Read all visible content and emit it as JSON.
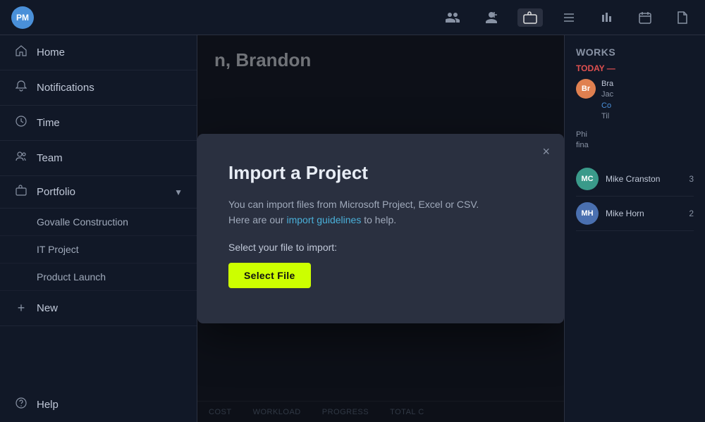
{
  "app": {
    "logo": "PM",
    "title_partial": "n, Brandon"
  },
  "top_nav": {
    "icons": [
      {
        "name": "members-icon",
        "symbol": "👥",
        "active": false
      },
      {
        "name": "team-icon",
        "symbol": "👤",
        "active": false
      },
      {
        "name": "briefcase-icon",
        "symbol": "💼",
        "active": true
      },
      {
        "name": "list-icon",
        "symbol": "≡",
        "active": false
      },
      {
        "name": "chart-icon",
        "symbol": "⏐⏐",
        "active": false
      },
      {
        "name": "calendar-icon",
        "symbol": "📅",
        "active": false
      },
      {
        "name": "document-icon",
        "symbol": "📄",
        "active": false
      }
    ]
  },
  "sidebar": {
    "items": [
      {
        "id": "home",
        "label": "Home",
        "icon": "⌂"
      },
      {
        "id": "notifications",
        "label": "Notifications",
        "icon": "🔔"
      },
      {
        "id": "time",
        "label": "Time",
        "icon": "⏱"
      },
      {
        "id": "team",
        "label": "Team",
        "icon": "👥"
      },
      {
        "id": "portfolio",
        "label": "Portfolio",
        "icon": "📁"
      }
    ],
    "portfolio_projects": [
      {
        "label": "Govalle Construction"
      },
      {
        "label": "IT Project"
      },
      {
        "label": "Product Launch"
      }
    ],
    "new_label": "New",
    "help_label": "Help"
  },
  "modal": {
    "title": "Import a Project",
    "description_part1": "You can import files from Microsoft Project, Excel or CSV.",
    "description_part2": "Here are our ",
    "link_text": "import guidelines",
    "description_part3": " to help.",
    "select_label": "Select your file to import:",
    "select_file_btn": "Select File",
    "close_label": "×"
  },
  "right_panel": {
    "title": "Works",
    "today_label": "TODAY —",
    "activity": [
      {
        "initials": "Br",
        "color": "#e08050",
        "name": "Bra",
        "text": "Jac\nCo\nTil"
      }
    ],
    "description_text": "Phi\nfina"
  },
  "members": [
    {
      "initials": "MC",
      "name": "Mike Cranston",
      "count": "3",
      "color": "#3a9a8a"
    },
    {
      "initials": "MH",
      "name": "Mike Horn",
      "count": "2",
      "color": "#4a70b0"
    }
  ],
  "bottom_bar": {
    "labels": [
      "COST",
      "WORKLOAD",
      "PROGRESS",
      "TOTAL C"
    ]
  }
}
